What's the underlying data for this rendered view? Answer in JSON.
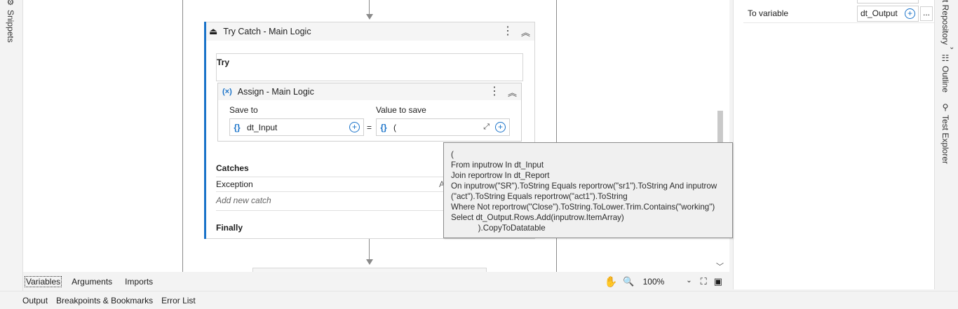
{
  "left_rail": {
    "snippets_label": "Snippets"
  },
  "try_catch": {
    "title": "Try Catch - Main Logic",
    "try_label": "Try",
    "catches_label": "Catches",
    "exception_label": "Exception",
    "exception_trunc": "A",
    "add_catch_label": "Add new catch",
    "finally_label": "Finally"
  },
  "assign": {
    "title": "Assign - Main Logic",
    "save_to_label": "Save to",
    "value_label": "Value to save",
    "save_to_value": "dt_Input",
    "equals": "=",
    "value_preview": "("
  },
  "tooltip": {
    "lines": [
      "(",
      "From inputrow In dt_Input",
      "Join reportrow In dt_Report",
      "On inputrow(\"SR\").ToString Equals reportrow(\"sr1\").ToString And inputrow",
      "(\"act\").ToString Equals reportrow(\"act1\").ToString",
      "Where Not reportrow(\"Close\").ToString.ToLower.Trim.Contains(\"working\")",
      "Select dt_Output.Rows.Add(inputrow.ItemArray)",
      "            ).CopyToDatatable"
    ]
  },
  "bottom_toolbar": {
    "tabs": [
      "Variables",
      "Arguments",
      "Imports"
    ],
    "zoom": "100%"
  },
  "footer": {
    "tabs": [
      "Output",
      "Breakpoints & Bookmarks",
      "Error List"
    ]
  },
  "properties": {
    "to_variable_label": "To variable",
    "to_variable_value": "dt_Output",
    "ellipsis": "..."
  },
  "right_rail": {
    "repository_label": "t Repository",
    "outline_label": "Outline",
    "test_explorer_label": "Test Explorer"
  },
  "colors": {
    "accent": "#1a73c9",
    "tooltip_bg": "#f0f0f0"
  }
}
